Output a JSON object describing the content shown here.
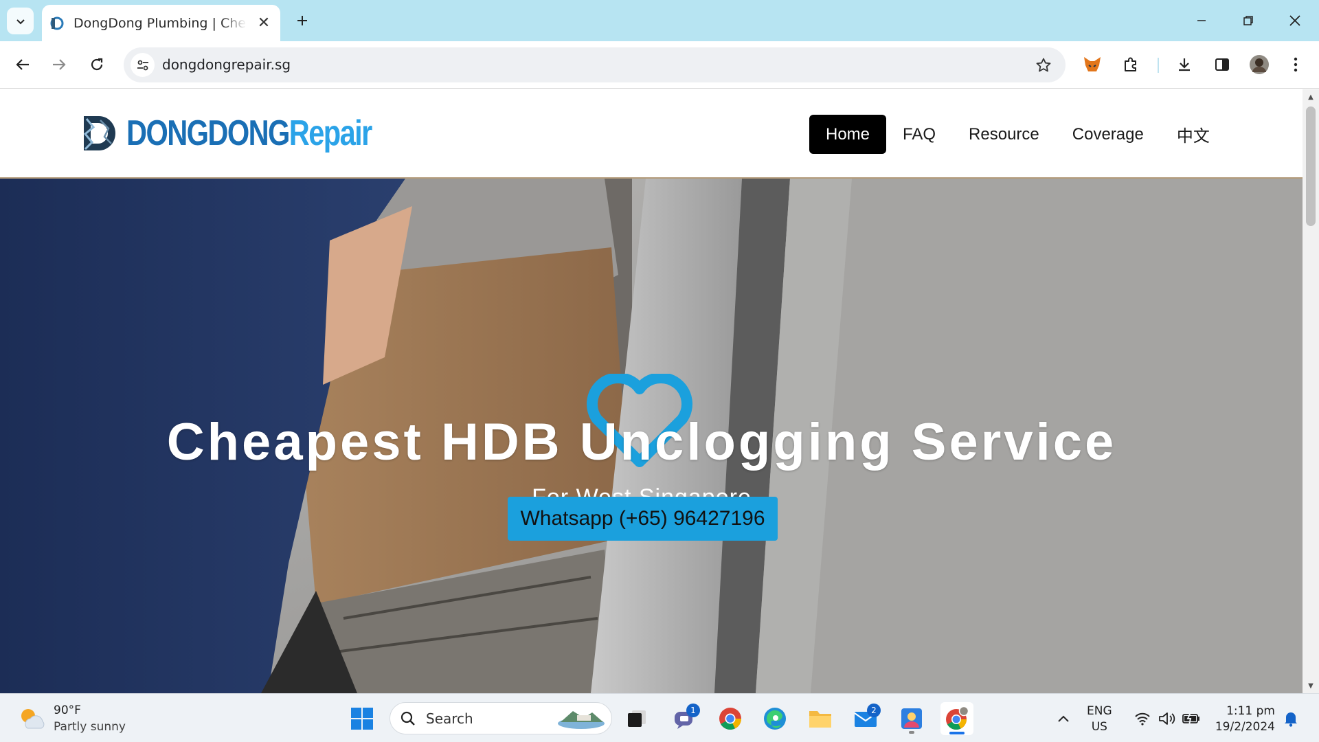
{
  "browser": {
    "tab": {
      "title": "DongDong Plumbing | Cheapest HDB Unclogging Service"
    },
    "address": {
      "url": "dongdongrepair.sg"
    }
  },
  "site": {
    "logo": {
      "part1": "DONGDONG",
      "part2": "Repair"
    },
    "nav": [
      {
        "label": "Home",
        "active": true
      },
      {
        "label": "FAQ"
      },
      {
        "label": "Resource"
      },
      {
        "label": "Coverage"
      },
      {
        "label": "中文"
      }
    ],
    "hero": {
      "title": "Cheapest HDB Unclogging Service",
      "subtitle": "For West Singapore",
      "cta": "Whatsapp (+65) 96427196"
    }
  },
  "taskbar": {
    "weather": {
      "temp": "90°F",
      "condition": "Partly sunny"
    },
    "search": {
      "label": "Search"
    },
    "badges": {
      "teams": "1",
      "mail": "2"
    },
    "language": {
      "line1": "ENG",
      "line2": "US"
    },
    "clock": {
      "time": "1:11 pm",
      "date": "19/2/2024"
    }
  },
  "colors": {
    "tabbar": "#b7e4f2",
    "logo_dark": "#1a6fb5",
    "logo_light": "#2ba3e8",
    "heart": "#1ba0dd",
    "cta_bg": "#1ba0dd",
    "nav_active_bg": "#000000"
  }
}
